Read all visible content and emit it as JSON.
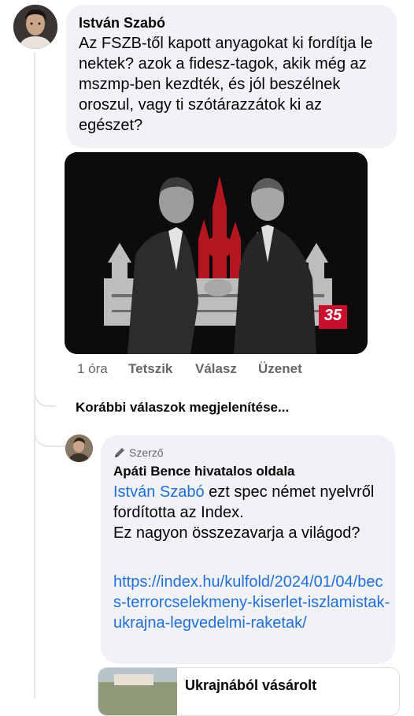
{
  "comment1": {
    "author": "István Szabó",
    "text": "Az FSZB-től kapott anyagokat ki fordítja le nektek? azok a fidesz-tagok, akik még az mszmp-ben kezdték, és jól beszélnek oroszul, vagy ti szótárazzátok ki az egészet?",
    "image_badge": "35",
    "time": "1 óra",
    "actions": [
      "Tetszik",
      "Válasz",
      "Üzenet"
    ]
  },
  "more_replies_label": "Korábbi válaszok megjelenítése...",
  "reply": {
    "badge_icon": "pencil-icon",
    "badge_label": "Szerző",
    "author": "Apáti Bence hivatalos oldala",
    "mention": "István Szabó",
    "text_after_mention": " ezt spec német nyelvről fordította az Index.",
    "text_line2": "Ez nagyon összezavarja a világod?",
    "link": "https://index.hu/kulfold/2024/01/04/becs-terrorcselekmeny-kiserlet-iszlamistak-ukrajna-legvedelmi-raketak/"
  },
  "link_preview": {
    "title": "Ukrajnából vásárolt"
  },
  "colors": {
    "bubble": "#f0f2f5",
    "link": "#216fdb",
    "secondary_text": "#65676b",
    "badge_red": "#c8102e"
  }
}
